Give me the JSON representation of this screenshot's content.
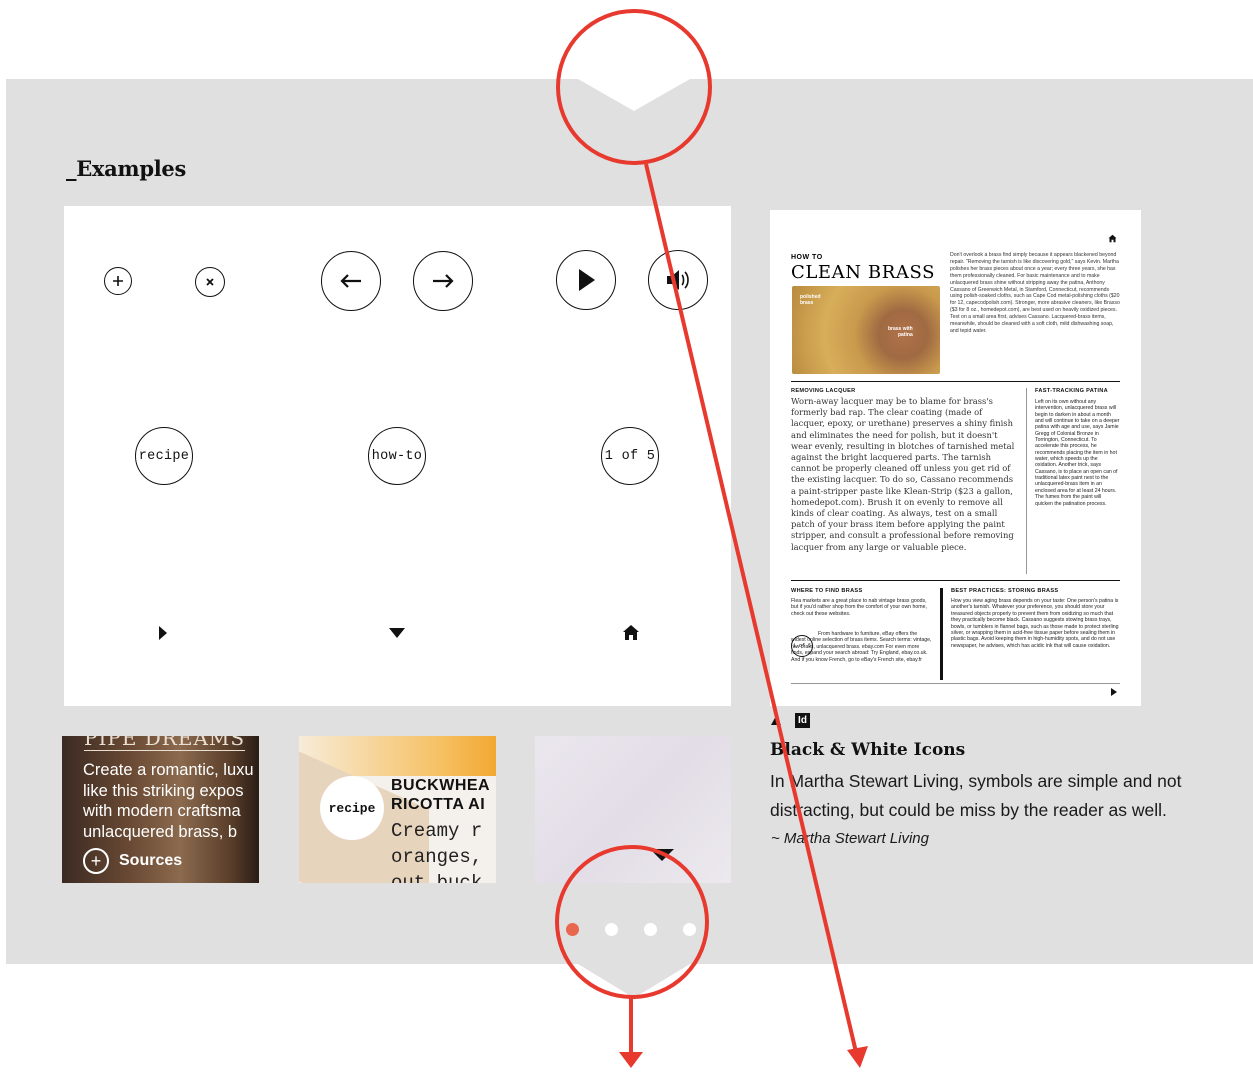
{
  "section": {
    "title": "_Examples"
  },
  "icon_card": {
    "text_icons": {
      "recipe": "recipe",
      "howto": "how-to",
      "pager": "1 of 5"
    }
  },
  "thumbnails": [
    {
      "heading": "PIPE DREAMS",
      "body": [
        "Create a romantic, luxu",
        "like this striking expos",
        "with modern craftsma",
        "unlacquered brass, b"
      ],
      "sources_label": "Sources"
    },
    {
      "badge": "recipe",
      "title": [
        "BUCKWHEA",
        "RICOTTA AI"
      ],
      "mono": [
        "Creamy r",
        "oranges,",
        "out buck"
      ]
    },
    {}
  ],
  "pagination": {
    "count": 4,
    "active_index": 0,
    "active_color": "#e9664f"
  },
  "magazine": {
    "kicker": "HOW TO",
    "title": "CLEAN BRASS",
    "photo_left_label": [
      "polished",
      "brass"
    ],
    "photo_right_label": [
      "brass with",
      "patina"
    ],
    "intro": "Don't overlook a brass find simply because it appears blackened beyond repair. \"Removing the tarnish is like discovering gold,\" says Kevin. Martha polishes her brass pieces about once a year; every three years, she has them professionally cleaned. For basic maintenance and to make unlacquered brass shine without stripping away the patina, Anthony Cassano of Greenwich Metal, in Stamford, Connecticut, recommends using polish-soaked cloths, such as Cape Cod metal-polishing cloths ($20 for 12, capecodpolish.com). Stronger, more abrasive cleaners, like Brasso ($3 for 8 oz., homedepot.com), are best used on heavily oxidized pieces. Test on a small area first, advises Cassano. Lacquered-brass items, meanwhile, should be cleaned with a soft cloth, mild dishwashing soap, and tepid water.",
    "removing_head": "REMOVING LACQUER",
    "removing_body": "Worn-away lacquer may be to blame for brass's formerly bad rap. The clear coating (made of lacquer, epoxy, or urethane) preserves a shiny finish and eliminates the need for polish, but it doesn't wear evenly, resulting in blotches of tarnished metal against the bright lacquered parts. The tarnish cannot be properly cleaned off unless you get rid of the existing lacquer. To do so, Cassano recommends a paint-stripper paste like Klean-Strip ($23 a gallon, homedepot.com). Brush it on evenly to remove all kinds of clear coating. As always, test on a small patch of your brass item before applying the paint stripper, and consult a professional before removing lacquer from any large or valuable piece.",
    "fast_head": "FAST-TRACKING PATINA",
    "fast_body": "Left on its own without any intervention, unlacquered brass will begin to darken in about a month and will continue to take on a deeper patina with age and use, says Jamie Gregg of Colonial Bronze in Torrington, Connecticut. To accelerate this process, he recommends placing the item in hot water, which speeds up the oxidation. Another trick, says Cassano, is to place an open can of traditional latex paint next to the unlacquered-brass item in an enclosed area for at least 24 hours. The fumes from the paint will quicken the patination process.",
    "where_head": "WHERE TO FIND BRASS",
    "where_body": "Flea markets are a great place to nab vintage brass goods, but if you'd rather shop from the comfort of your own home, check out these websites.",
    "where_body2": "From hardware to furniture, eBay offers the widest online selection of brass items. Search terms: vintage, raw brass, unlacquered brass. ebay.com For even more finds, expand your search abroad: Try England, ebay.co.uk. And if you know French, go to eBay's French site, ebay.fr",
    "pager": "1 of 5",
    "best_head": "BEST PRACTICES: STORING BRASS",
    "best_body": "How you view aging brass depends on your taste: One person's patina is another's tarnish. Whatever your preference, you should store your treasured objects properly to prevent them from oxidizing so much that they practically become black. Cassano suggests stowing brass trays, bowls, or tumblers in flannel bags, such as those made to protect sterling silver, or wrapping them in acid-free tissue paper before sealing them in plastic bags. Avoid keeping them in high-humidity spots, and do not use newspaper, he advises, which has acidic ink that will cause oxidation."
  },
  "caption": {
    "tool_badge": "Id",
    "title": "Black & White Icons",
    "body": "In Martha Stewart Living, symbols are simple and not distracting, but could be miss by the reader as well.",
    "source": "~ Martha Stewart Living"
  },
  "annotation_color": "#e8392f"
}
